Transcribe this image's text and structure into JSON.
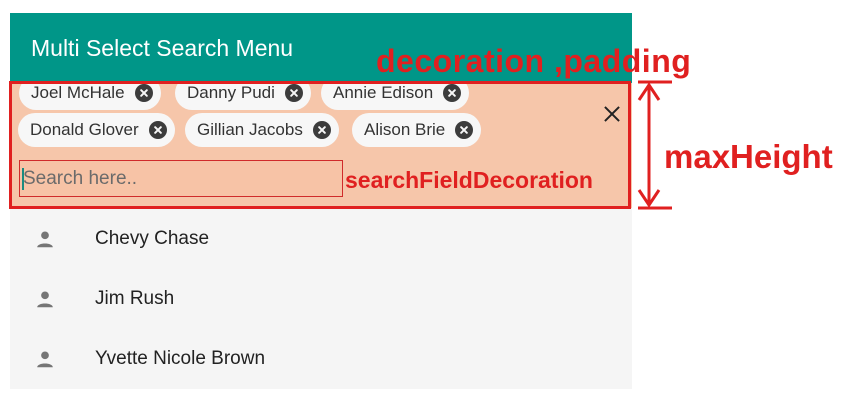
{
  "app": {
    "title": "Multi Select Search Menu"
  },
  "selected_chips": [
    {
      "label": "Joel McHale"
    },
    {
      "label": "Danny Pudi"
    },
    {
      "label": "Annie Edison"
    },
    {
      "label": "Donald Glover"
    },
    {
      "label": "Gillian Jacobs"
    },
    {
      "label": "Alison Brie"
    }
  ],
  "search": {
    "placeholder": "Search here..",
    "value": ""
  },
  "list": [
    {
      "label": "Chevy Chase",
      "icon": "person-icon"
    },
    {
      "label": "Jim Rush",
      "icon": "person-icon"
    },
    {
      "label": "Yvette Nicole Brown",
      "icon": "person-icon"
    }
  ],
  "annotations": {
    "decoration_padding": "decoration ,padding",
    "search_field_decoration": "searchFieldDecoration",
    "max_height": "maxHeight"
  },
  "colors": {
    "app_bar": "#009688",
    "panel_background": "#f6c6aa",
    "annotation": "#e02020"
  }
}
